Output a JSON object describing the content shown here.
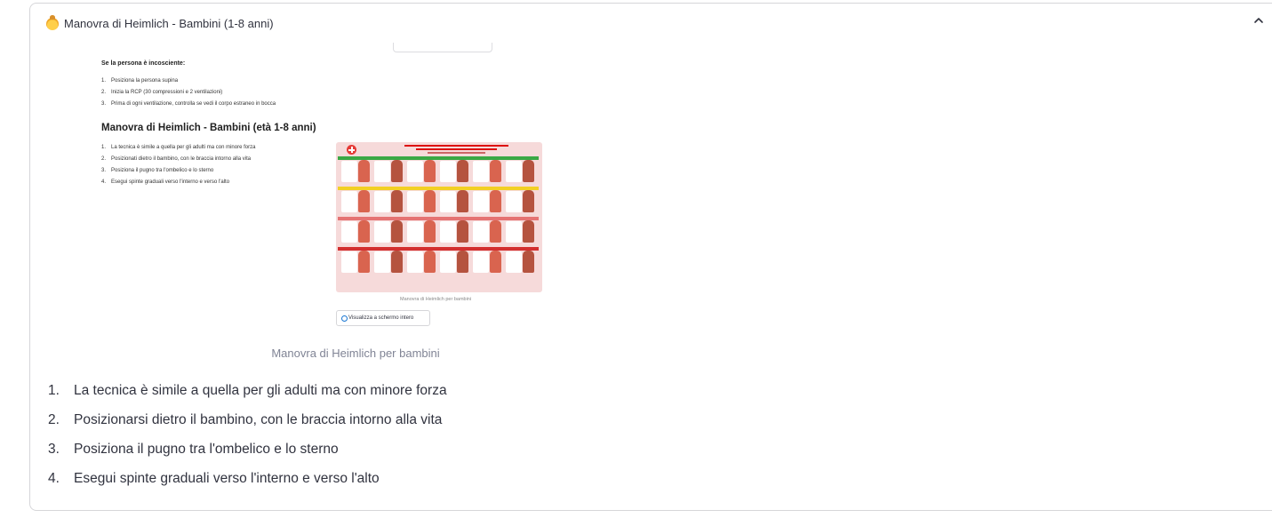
{
  "expander": {
    "icon": "baby-emoji",
    "title": "Manovra di Heimlich - Bambini (1-8 anni)",
    "state": "expanded"
  },
  "embedded_screenshot": {
    "unconscious_heading": "Se la persona è incosciente:",
    "unconscious_steps": [
      {
        "n": "1.",
        "text": "Posiziona la persona supina"
      },
      {
        "n": "2.",
        "text": "Inizia la RCP (30 compressioni e 2 ventilazioni)"
      },
      {
        "n": "3.",
        "text": "Prima di ogni ventilazione, controlla se vedi il corpo estraneo in bocca"
      }
    ],
    "section_heading": "Manovra di Heimlich - Bambini (età 1-8 anni)",
    "section_steps": [
      {
        "n": "1.",
        "text": "La tecnica è simile a quella per gli adulti ma con minore forza"
      },
      {
        "n": "2.",
        "text": "Posizionati dietro il bambino, con le braccia intorno alla vita"
      },
      {
        "n": "3.",
        "text": "Posiziona il pugno tra l'ombelico e lo sterno"
      },
      {
        "n": "4.",
        "text": "Esegui spinte graduali verso l'interno e verso l'alto"
      }
    ],
    "image_caption": "Manovra di Heimlich per bambini",
    "fullscreen_button": "Visualizza a schermo intero",
    "colors": {
      "band_green": "#3aa845",
      "band_yellow": "#f2d024",
      "band_red": "#d32f2f",
      "band_pink": "#e57373"
    }
  },
  "caption": "Manovra di Heimlich per bambini",
  "steps": [
    {
      "n": "1.",
      "text": "La tecnica è simile a quella per gli adulti ma con minore forza"
    },
    {
      "n": "2.",
      "text": "Posizionarsi dietro il bambino, con le braccia intorno alla vita"
    },
    {
      "n": "3.",
      "text": "Posiziona il pugno tra l'ombelico e lo sterno"
    },
    {
      "n": "4.",
      "text": "Esegui spinte graduali verso l'interno e verso l'alto"
    }
  ]
}
